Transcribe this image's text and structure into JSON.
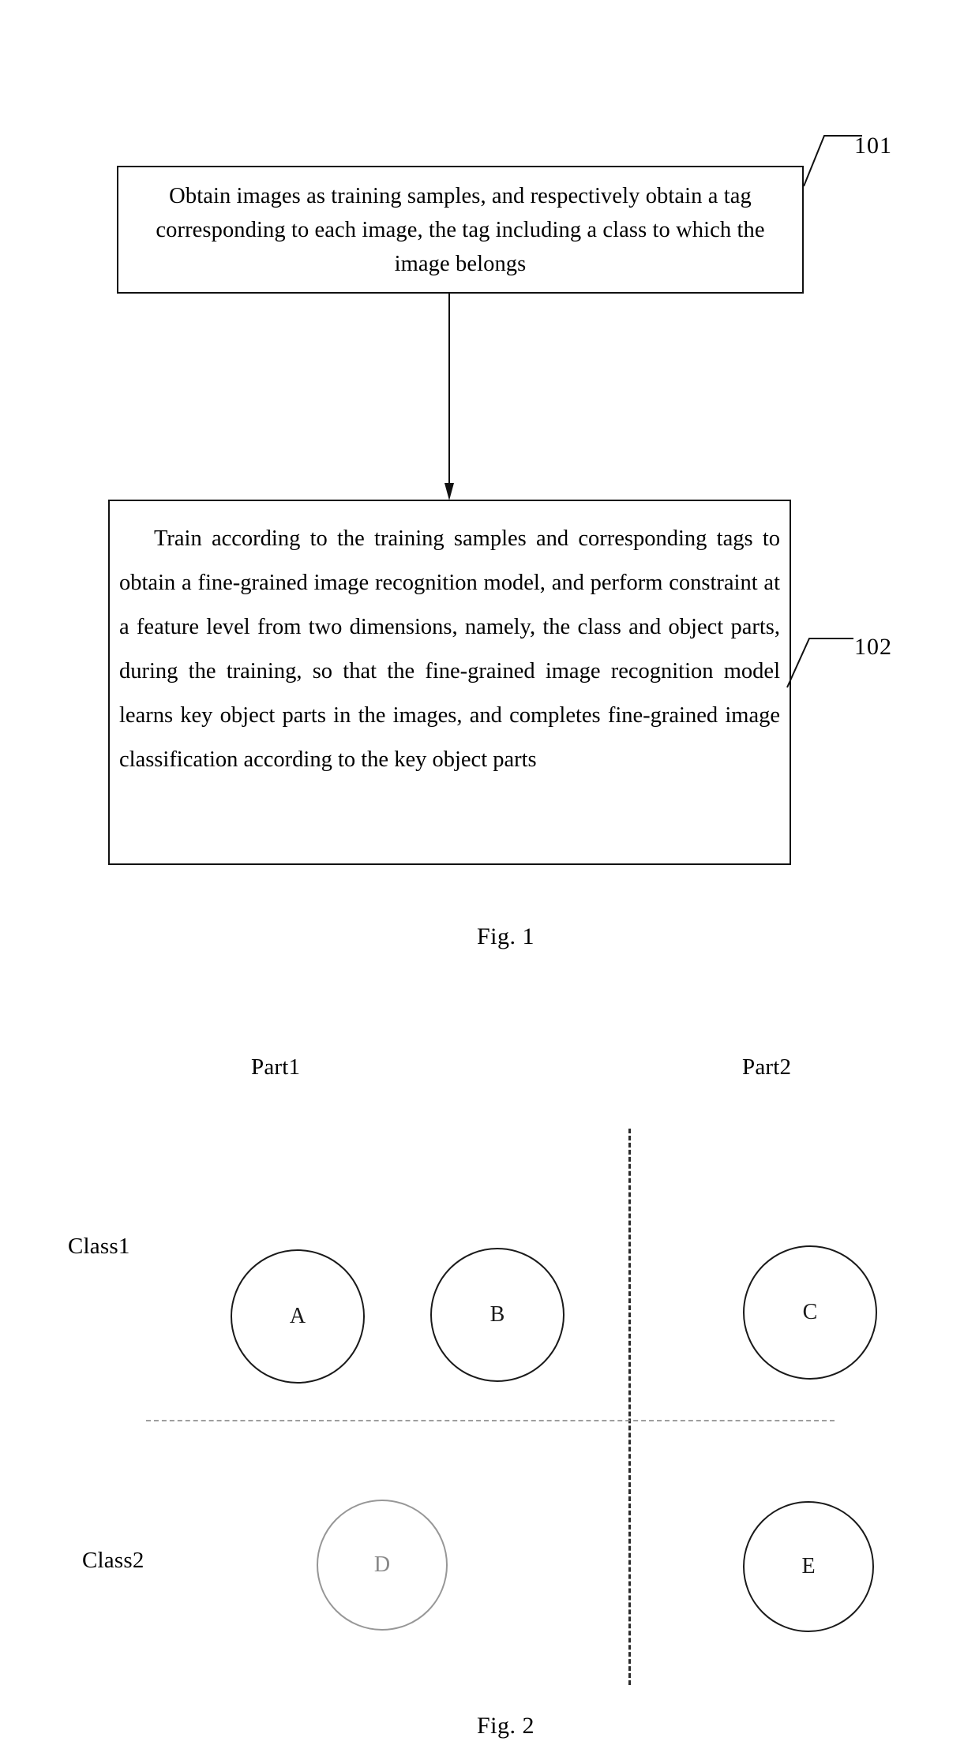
{
  "figure1": {
    "steps": [
      {
        "id": "101",
        "text": "Obtain images as training samples, and respectively obtain a tag corresponding to each image, the tag including a class to which the image belongs"
      },
      {
        "id": "102",
        "text": "Train according to the training samples and corresponding tags to obtain a fine-grained image recognition model, and perform constraint at a feature level from two dimensions, namely, the class and object parts, during the training, so that the fine-grained image recognition model learns key object parts in the images, and completes fine-grained image classification according to the key object parts"
      }
    ],
    "caption": "Fig. 1"
  },
  "figure2": {
    "column_headers": [
      {
        "label": "Part1"
      },
      {
        "label": "Part2"
      }
    ],
    "row_headers": [
      {
        "label": "Class1"
      },
      {
        "label": "Class2"
      }
    ],
    "nodes": [
      {
        "label": "A",
        "row": "Class1",
        "column": "Part1"
      },
      {
        "label": "B",
        "row": "Class1",
        "column": "Part1"
      },
      {
        "label": "C",
        "row": "Class1",
        "column": "Part2"
      },
      {
        "label": "D",
        "row": "Class2",
        "column": "Part1"
      },
      {
        "label": "E",
        "row": "Class2",
        "column": "Part2"
      }
    ],
    "caption": "Fig. 2"
  },
  "colors": {
    "ink": "#111111",
    "faded_ink": "#6f6f6f",
    "background": "#ffffff"
  }
}
